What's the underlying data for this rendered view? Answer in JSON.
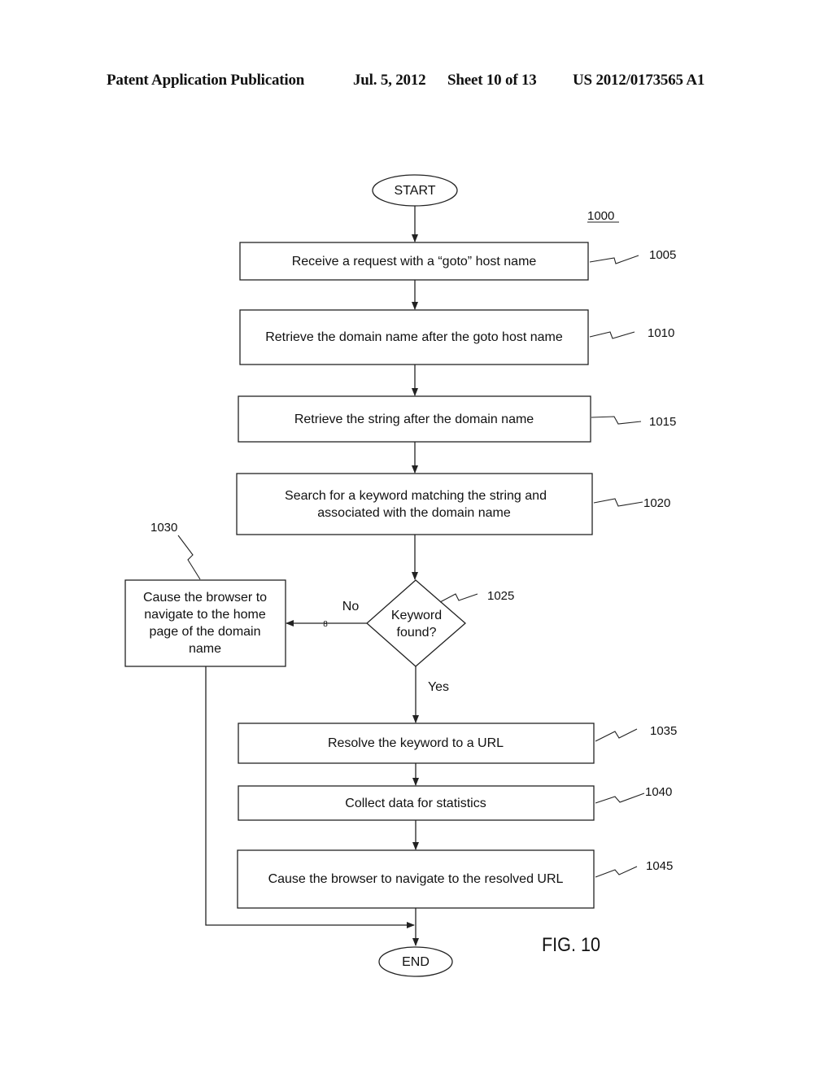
{
  "header": {
    "publication": "Patent Application Publication",
    "date": "Jul. 5, 2012",
    "sheet": "Sheet 10 of 13",
    "number": "US 2012/0173565 A1"
  },
  "figure": {
    "label": "FIG. 10",
    "ref": "1000"
  },
  "nodes": {
    "start": {
      "text": "START"
    },
    "end": {
      "text": "END"
    },
    "s1005": {
      "ref": "1005",
      "lines": [
        "Receive a request with a “goto” host name"
      ]
    },
    "s1010": {
      "ref": "1010",
      "lines": [
        "Retrieve the domain name after the goto host name"
      ]
    },
    "s1015": {
      "ref": "1015",
      "lines": [
        "Retrieve the string after the domain name"
      ]
    },
    "s1020": {
      "ref": "1020",
      "lines": [
        "Search for a keyword matching the string and",
        "associated with the domain name"
      ]
    },
    "s1025": {
      "ref": "1025",
      "lines": [
        "Keyword",
        "found?"
      ]
    },
    "s1030": {
      "ref": "1030",
      "lines": [
        "Cause the browser to",
        "navigate to the home",
        "page of the domain",
        "name"
      ]
    },
    "s1035": {
      "ref": "1035",
      "lines": [
        "Resolve the keyword to a URL"
      ]
    },
    "s1040": {
      "ref": "1040",
      "lines": [
        "Collect data for statistics"
      ]
    },
    "s1045": {
      "ref": "1045",
      "lines": [
        "Cause the browser to navigate to the resolved URL"
      ]
    }
  },
  "edges": {
    "no_label": "No",
    "yes_label": "Yes",
    "no_mark": "8"
  }
}
